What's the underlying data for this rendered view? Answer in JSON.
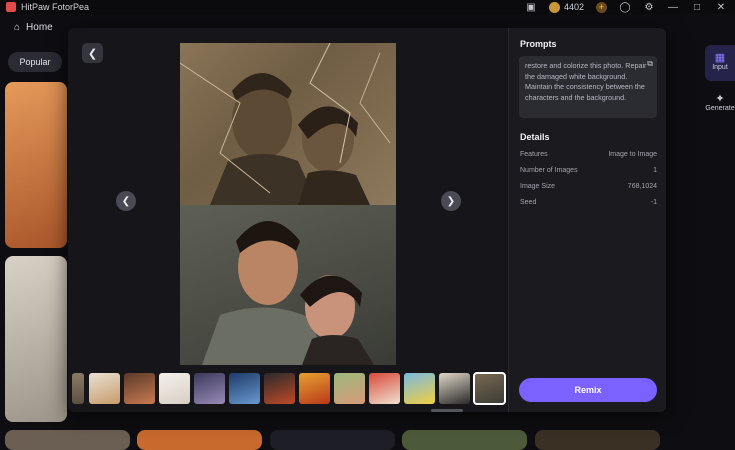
{
  "app": {
    "title": "HitPaw FotorPea",
    "coins": "4402"
  },
  "window_icons": {
    "add_coins": "plus-icon",
    "user": "user-icon",
    "settings": "gear-icon",
    "minimize": "minimize-icon",
    "maximize": "maximize-icon",
    "close": "close-icon"
  },
  "nav": {
    "home_label": "Home",
    "popular_label": "Popular"
  },
  "right_rail": [
    {
      "label": "Input",
      "icon": "grid-icon"
    },
    {
      "label": "Generate",
      "icon": "sparkle-icon"
    }
  ],
  "modal": {
    "prompts_title": "Prompts",
    "prompt_text": "restore and colorize this photo. Repair the damaged white background. Maintain the consistency between the characters and the background.",
    "details_title": "Details",
    "details": [
      {
        "label": "Features",
        "value": "Image to Image"
      },
      {
        "label": "Number of Images",
        "value": "1"
      },
      {
        "label": "Image Size",
        "value": "768,1024"
      },
      {
        "label": "Seed",
        "value": "-1"
      }
    ],
    "remix_label": "Remix",
    "thumbnails_count": 13,
    "selected_thumbnail": 13
  },
  "colors": {
    "accent": "#7b61ff",
    "modal_bg": "#1a1a1f",
    "page_bg": "#0e0e12"
  }
}
